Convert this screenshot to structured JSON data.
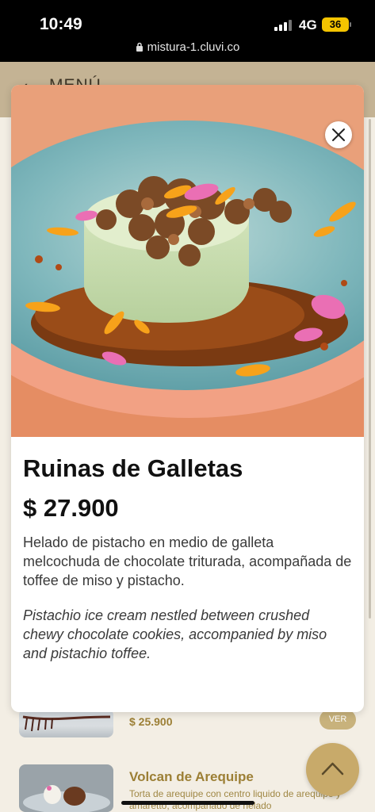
{
  "status_bar": {
    "time": "10:49",
    "network": "4G",
    "battery": "36",
    "url": "mistura-1.cluvi.co"
  },
  "header": {
    "back_icon": "chevron-left-icon",
    "title": "MENÚ"
  },
  "modal": {
    "dish_name": "Ruinas de Galletas",
    "price": "$ 27.900",
    "description_es": "Helado de pistacho en medio de galleta melcochuda de chocolate triturada, acompañada de toffee de miso y pistacho.",
    "description_en": "Pistachio ice cream nestled between crushed chewy chocolate cookies, accompanied by miso and pistachio toffee.",
    "close_icon": "close-icon"
  },
  "list": {
    "items": [
      {
        "price": "$ 25.900",
        "button": "VER"
      },
      {
        "name": "Volcan de Arequipe",
        "description": "Torta de arequipe con centro liquido de arequipe y amaretto, acompañado de helado"
      }
    ]
  },
  "scroll_top_icon": "chevron-up-icon",
  "colors": {
    "header_bg": "#c4b394",
    "accent_gold": "#9c7f35",
    "scroll_button": "#c8aa6a",
    "page_bg": "#f3eee4"
  }
}
